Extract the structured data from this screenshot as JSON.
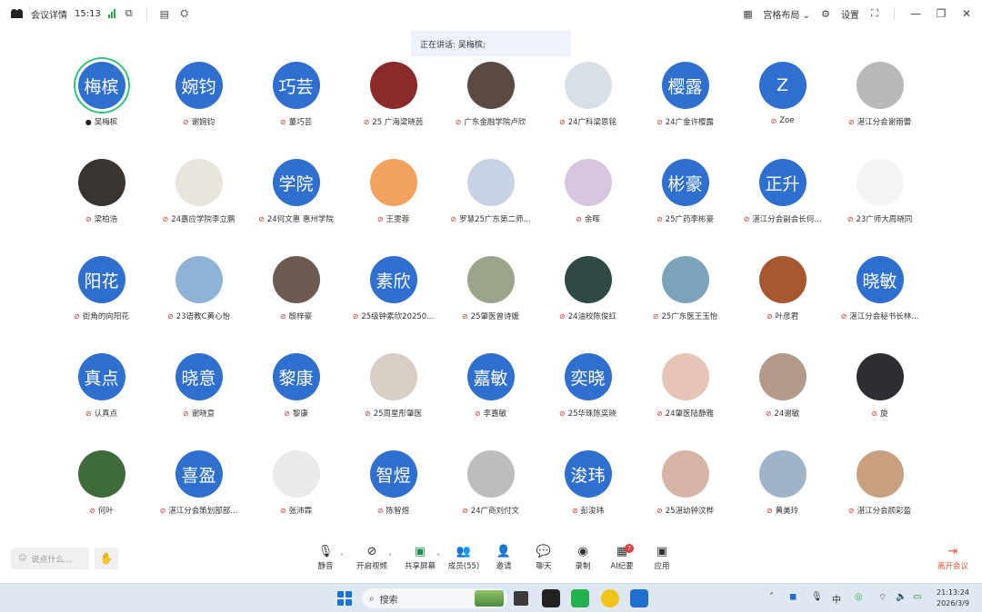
{
  "titlebar": {
    "app_label": "会议详情",
    "time": "15:13",
    "layout_label": "宫格布局",
    "settings_label": "设置"
  },
  "speaking": {
    "text": "正在讲话: 吴梅槟;"
  },
  "participants": [
    {
      "name": "吴梅槟",
      "avatar_text": "梅槟",
      "mic": "on",
      "speaking": true
    },
    {
      "name": "谢婉钧",
      "avatar_text": "婉钧",
      "mic": "muted"
    },
    {
      "name": "董巧芸",
      "avatar_text": "巧芸",
      "mic": "muted"
    },
    {
      "name": "25 广海梁晓茵",
      "avatar_text": "",
      "avatar_color": "#8b2a2a",
      "mic": "muted"
    },
    {
      "name": "广东金融学院卢欣",
      "avatar_text": "",
      "avatar_color": "#5a4a42",
      "mic": "muted"
    },
    {
      "name": "24广科梁恩铭",
      "avatar_text": "",
      "avatar_color": "#d9dfe6",
      "mic": "muted"
    },
    {
      "name": "24广金许樱露",
      "avatar_text": "樱露",
      "mic": "muted"
    },
    {
      "name": "Zoe",
      "avatar_text": "Z",
      "mic": "muted"
    },
    {
      "name": "湛江分会谢雨蕾",
      "avatar_text": "",
      "avatar_color": "#b9b9b9",
      "mic": "muted"
    },
    {
      "name": "梁柏浩",
      "avatar_text": "",
      "avatar_color": "#3a3430",
      "mic": "muted"
    },
    {
      "name": "24嘉应学院李立鹏",
      "avatar_text": "",
      "avatar_color": "#e9e4dc",
      "mic": "muted"
    },
    {
      "name": "24何文惠 惠州学院",
      "avatar_text": "学院",
      "mic": "muted"
    },
    {
      "name": "王雯蓉",
      "avatar_text": "",
      "avatar_color": "#f2a25c",
      "mic": "muted"
    },
    {
      "name": "罗慧25广东第二师...",
      "avatar_text": "",
      "avatar_color": "#c7d2e4",
      "mic": "muted"
    },
    {
      "name": "余晖",
      "avatar_text": "",
      "avatar_color": "#d8c6e0",
      "mic": "muted"
    },
    {
      "name": "25广药李彬豪",
      "avatar_text": "彬豪",
      "mic": "muted"
    },
    {
      "name": "湛江分会副会长何...",
      "avatar_text": "正升",
      "mic": "muted"
    },
    {
      "name": "23广师大周晓同",
      "avatar_text": "",
      "avatar_color": "#f4f4f4",
      "mic": "muted"
    },
    {
      "name": "街角的向阳花",
      "avatar_text": "阳花",
      "mic": "muted"
    },
    {
      "name": "23语教C黄心怡",
      "avatar_text": "",
      "avatar_color": "#8fb3d6",
      "mic": "muted"
    },
    {
      "name": "殷梓豪",
      "avatar_text": "",
      "avatar_color": "#6d5b52",
      "mic": "muted"
    },
    {
      "name": "25级钟素欣20250...",
      "avatar_text": "素欣",
      "mic": "muted"
    },
    {
      "name": "25肇医曾诗媛",
      "avatar_text": "",
      "avatar_color": "#9aa58c",
      "mic": "muted"
    },
    {
      "name": "24油校陈俊红",
      "avatar_text": "",
      "avatar_color": "#2f4a45",
      "mic": "muted"
    },
    {
      "name": "25广东医王玉怡",
      "avatar_text": "",
      "avatar_color": "#7ba3b9",
      "mic": "muted"
    },
    {
      "name": "叶彦君",
      "avatar_text": "",
      "avatar_color": "#a8582f",
      "mic": "muted"
    },
    {
      "name": "湛江分会秘书长林...",
      "avatar_text": "晓敏",
      "mic": "muted"
    },
    {
      "name": "认真点",
      "avatar_text": "真点",
      "mic": "muted"
    },
    {
      "name": "谢晓意",
      "avatar_text": "晓意",
      "mic": "muted"
    },
    {
      "name": "黎康",
      "avatar_text": "黎康",
      "mic": "muted"
    },
    {
      "name": "25周星彤肇医",
      "avatar_text": "",
      "avatar_color": "#d7cfc6",
      "mic": "muted"
    },
    {
      "name": "李嘉敏",
      "avatar_text": "嘉敏",
      "mic": "muted"
    },
    {
      "name": "25华珠陈奕晓",
      "avatar_text": "奕晓",
      "mic": "muted"
    },
    {
      "name": "24肇医陆静雅",
      "avatar_text": "",
      "avatar_color": "#e6c4b6",
      "mic": "muted"
    },
    {
      "name": "24谢敏",
      "avatar_text": "",
      "avatar_color": "#b49a8a",
      "mic": "muted"
    },
    {
      "name": "旋",
      "avatar_text": "",
      "avatar_color": "#2d2d33",
      "mic": "muted"
    },
    {
      "name": "何叶",
      "avatar_text": "",
      "avatar_color": "#3f6b3a",
      "mic": "muted"
    },
    {
      "name": "湛江分会策划部部...",
      "avatar_text": "喜盈",
      "mic": "muted"
    },
    {
      "name": "张沛霖",
      "avatar_text": "",
      "avatar_color": "#eaeaea",
      "mic": "muted"
    },
    {
      "name": "陈智煜",
      "avatar_text": "智煜",
      "mic": "muted"
    },
    {
      "name": "24广商刘付文",
      "avatar_text": "",
      "avatar_color": "#bdbdbd",
      "mic": "muted"
    },
    {
      "name": "彭浚玮",
      "avatar_text": "浚玮",
      "mic": "muted"
    },
    {
      "name": "25湛幼钟汶桦",
      "avatar_text": "",
      "avatar_color": "#d7b3a8",
      "mic": "muted"
    },
    {
      "name": "黄美玲",
      "avatar_text": "",
      "avatar_color": "#9fb4c8",
      "mic": "muted"
    },
    {
      "name": "湛江分会颜彩盈",
      "avatar_text": "",
      "avatar_color": "#c9a07f",
      "mic": "muted"
    }
  ],
  "toolbar": {
    "chat_placeholder": "说点什么...",
    "mute": "静音",
    "video": "开启视频",
    "share": "共享屏幕",
    "members": "成员(55)",
    "invite": "邀请",
    "chat": "聊天",
    "record": "录制",
    "ai_notes": "AI纪要",
    "ai_badge": "7",
    "apps": "应用",
    "leave": "离开会议"
  },
  "taskbar": {
    "search_label": "搜索",
    "ime": "中",
    "clock_time": "21:13:24",
    "clock_date": "2026/3/9"
  }
}
